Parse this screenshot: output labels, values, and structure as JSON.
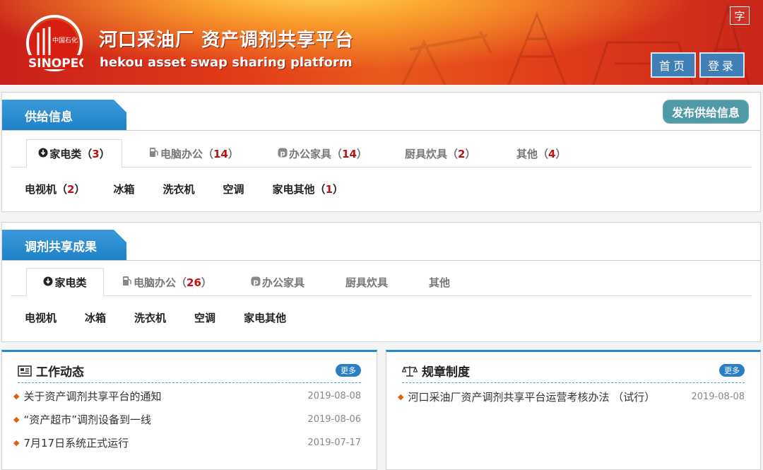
{
  "header": {
    "title": "河口采油厂 资产调剂共享平台",
    "subtitle": "hekou asset swap sharing platform",
    "logo_text": "中国石化",
    "logo_brand": "SINOPEC",
    "font_toggle": "字",
    "nav": [
      {
        "label": "首页"
      },
      {
        "label": "登录"
      }
    ]
  },
  "supply": {
    "title": "供给信息",
    "publish_button": "发布供给信息",
    "tabs": [
      {
        "label": "家电类",
        "count": "3",
        "icon": "download-circle-icon"
      },
      {
        "label": "电脑办公",
        "count": "14",
        "icon": "fuel-pump-icon"
      },
      {
        "label": "办公家具",
        "count": "14",
        "icon": "p-badge-icon"
      },
      {
        "label": "厨具炊具",
        "count": "2"
      },
      {
        "label": "其他",
        "count": "4"
      }
    ],
    "subitems": [
      {
        "label": "电视机",
        "count": "2"
      },
      {
        "label": "冰箱"
      },
      {
        "label": "洗衣机"
      },
      {
        "label": "空调"
      },
      {
        "label": "家电其他",
        "count": "1"
      }
    ]
  },
  "results": {
    "title": "调剂共享成果",
    "tabs": [
      {
        "label": "家电类",
        "icon": "download-circle-icon"
      },
      {
        "label": "电脑办公",
        "count": "26",
        "icon": "fuel-pump-icon"
      },
      {
        "label": "办公家具",
        "icon": "p-badge-icon"
      },
      {
        "label": "厨具炊具"
      },
      {
        "label": "其他"
      }
    ],
    "subitems": [
      "电视机",
      "冰箱",
      "洗衣机",
      "空调",
      "家电其他"
    ]
  },
  "news": {
    "title": "工作动态",
    "more": "更多",
    "items": [
      {
        "title": "关于资产调剂共享平台的通知",
        "date": "2019-08-08"
      },
      {
        "title": "“资产超市”调剂设备到一线",
        "date": "2019-08-06"
      },
      {
        "title": "7月17日系统正式运行",
        "date": "2019-07-17"
      }
    ]
  },
  "rules": {
    "title": "规章制度",
    "more": "更多",
    "items": [
      {
        "title": "河口采油厂资产调剂共享平台运营考核办法 （试行）",
        "date": "2019-08-08"
      }
    ]
  },
  "colors": {
    "accent": "#1e88d0",
    "count": "#c01010",
    "header_red": "#e13a18",
    "publish": "#4f9aa6"
  }
}
